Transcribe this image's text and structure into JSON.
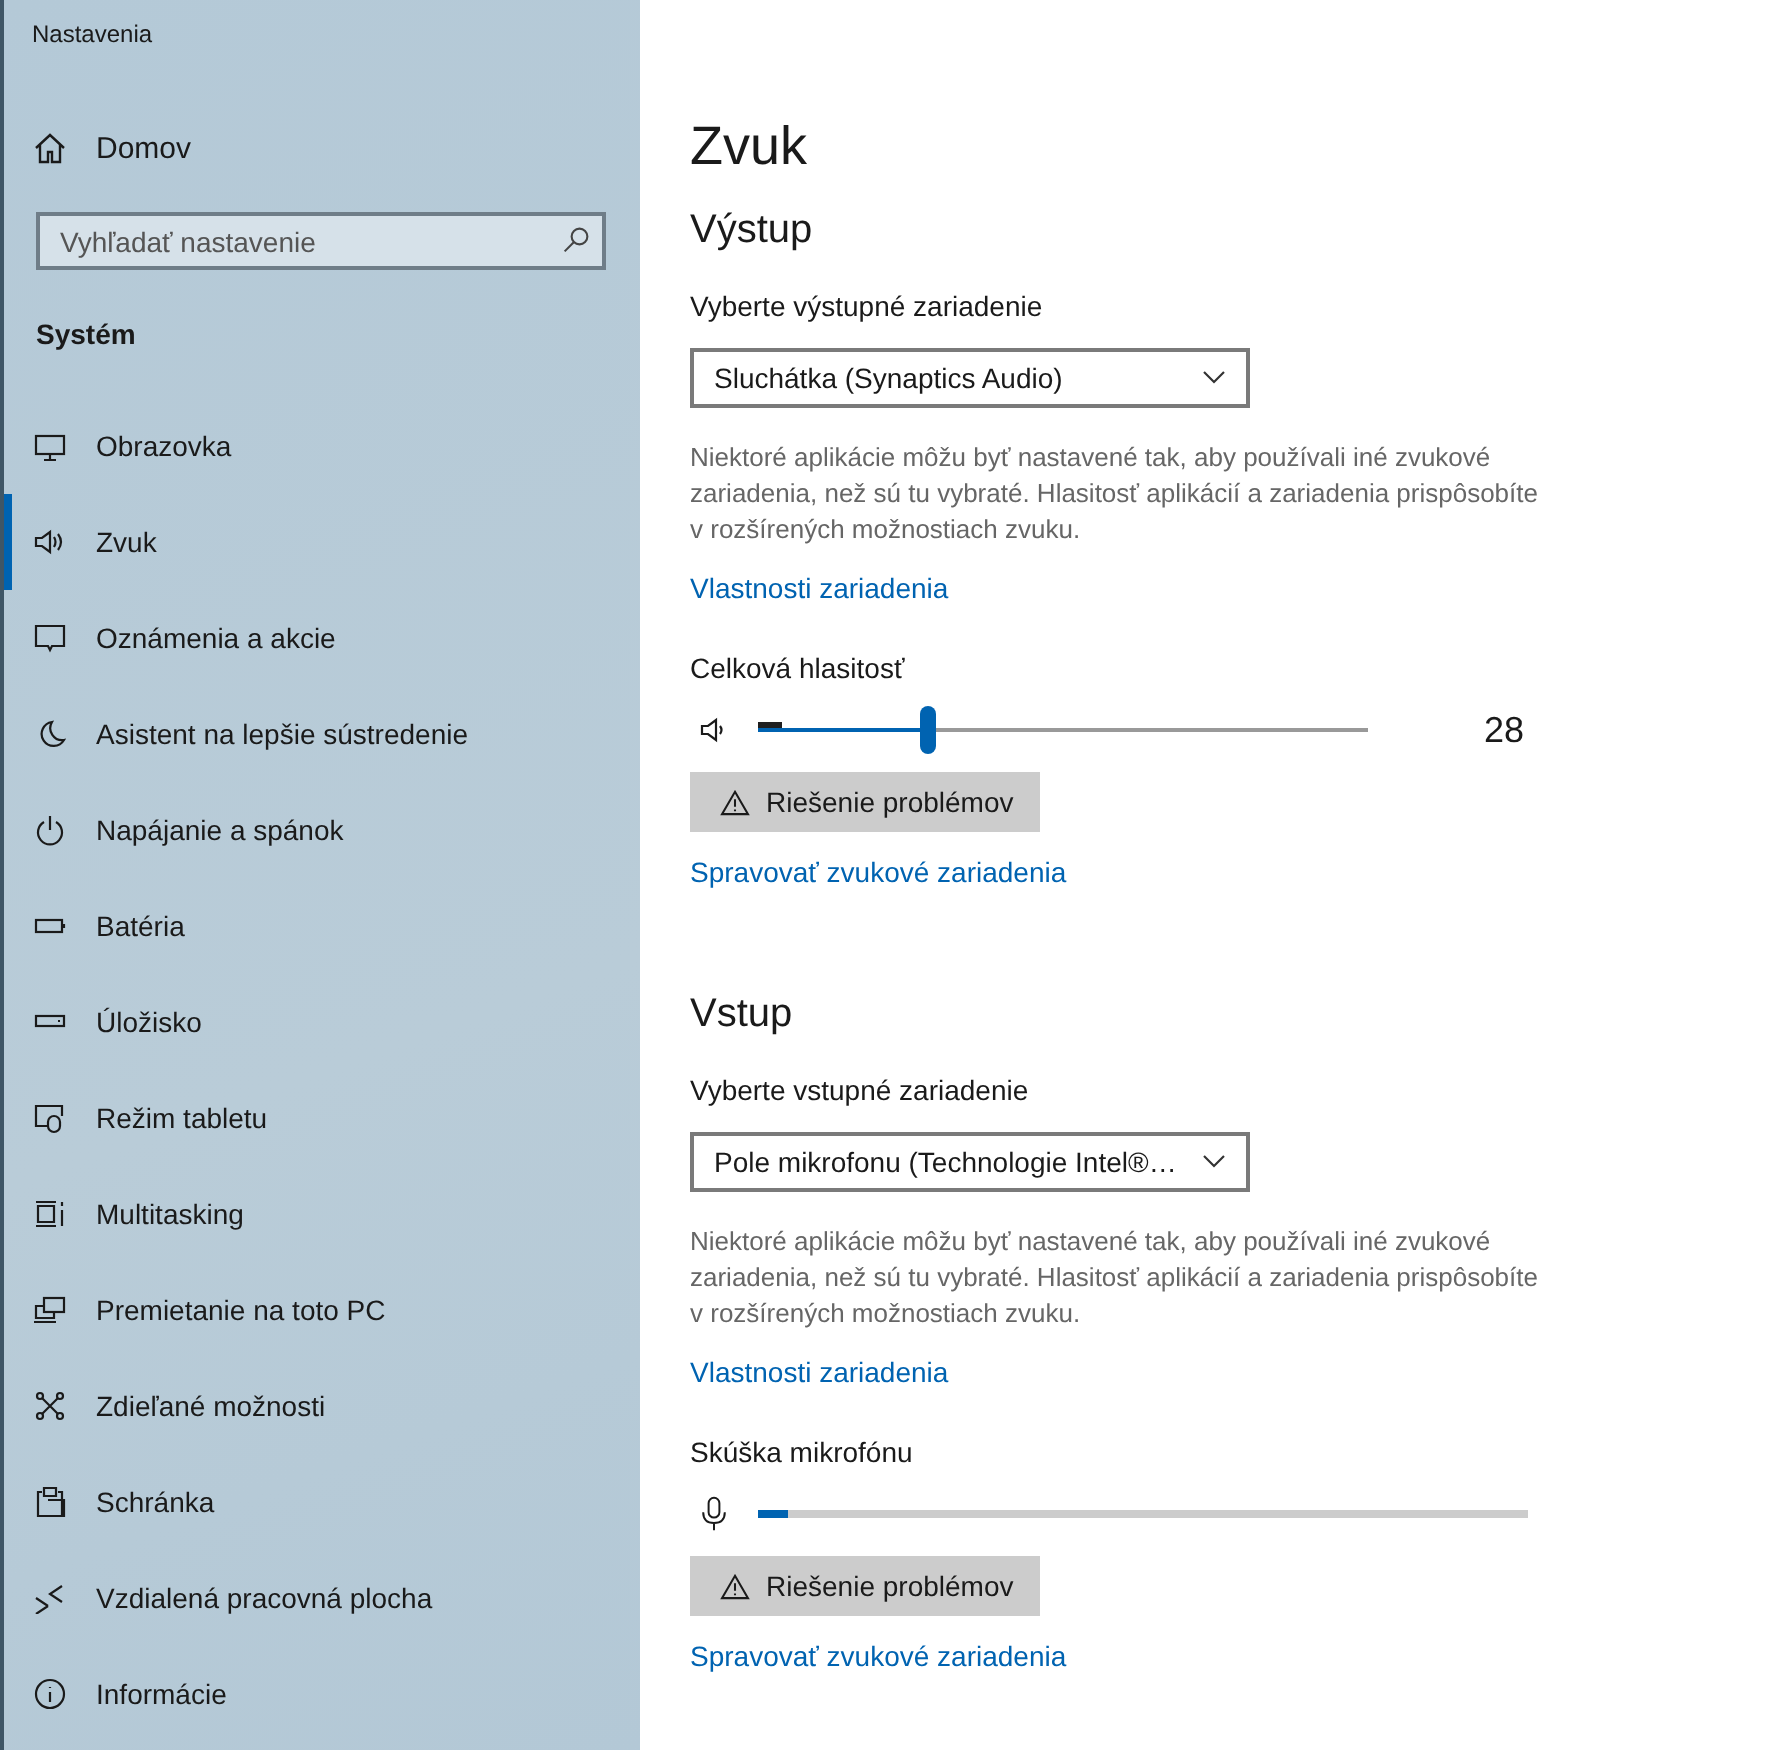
{
  "window": {
    "title": "Nastavenia"
  },
  "sidebar": {
    "home": "Domov",
    "search": {
      "placeholder": "Vyhľadať nastavenie"
    },
    "section": "Systém",
    "items": [
      {
        "label": "Obrazovka",
        "selected": false
      },
      {
        "label": "Zvuk",
        "selected": true
      },
      {
        "label": "Oznámenia a akcie",
        "selected": false
      },
      {
        "label": "Asistent na lepšie sústredenie",
        "selected": false
      },
      {
        "label": "Napájanie a spánok",
        "selected": false
      },
      {
        "label": "Batéria",
        "selected": false
      },
      {
        "label": "Úložisko",
        "selected": false
      },
      {
        "label": "Režim tabletu",
        "selected": false
      },
      {
        "label": "Multitasking",
        "selected": false
      },
      {
        "label": "Premietanie na toto PC",
        "selected": false
      },
      {
        "label": "Zdieľané možnosti",
        "selected": false
      },
      {
        "label": "Schránka",
        "selected": false
      },
      {
        "label": "Vzdialená pracovná plocha",
        "selected": false
      },
      {
        "label": "Informácie",
        "selected": false
      }
    ]
  },
  "page": {
    "title": "Zvuk",
    "sections": [
      {
        "heading": "Výstup",
        "device_label": "Vyberte výstupné zariadenie",
        "device": "Sluchátka (Synaptics Audio)",
        "note": "Niektoré aplikácie môžu byť nastavené tak, aby používali iné zvukové zariadenia, než sú tu vybraté. Hlasitosť aplikácií a zariadenia prispôsobíte v rozšírených možnostiach zvuku.",
        "properties_link": "Vlastnosti zariadenia",
        "meter": {
          "kind": "volume",
          "label": "Celková hlasitosť",
          "level": 0.28,
          "peak": {
            "level": 0.04
          },
          "reading": "28"
        },
        "troubleshoot": "Riešenie problémov",
        "manage_link": "Spravovať zvukové zariadenia"
      },
      {
        "heading": "Vstup",
        "device_label": "Vyberte vstupné zariadenie",
        "device": "Pole mikrofonu (Technologie Intel®…",
        "note": "Niektoré aplikácie môžu byť nastavené tak, aby používali iné zvukové zariadenia, než sú tu vybraté. Hlasitosť aplikácií a zariadenia prispôsobíte v rozšírených možnostiach zvuku.",
        "properties_link": "Vlastnosti zariadenia",
        "meter": {
          "kind": "microphone",
          "label": "Skúška mikrofónu",
          "level": 0.04
        },
        "troubleshoot": "Riešenie problémov",
        "manage_link": "Spravovať zvukové zariadenia"
      }
    ]
  }
}
